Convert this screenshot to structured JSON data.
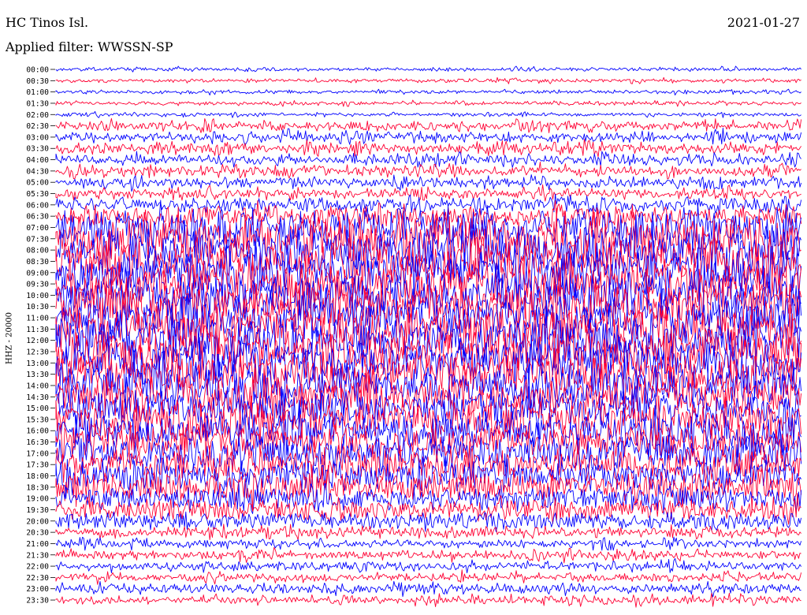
{
  "header": {
    "station": "HC Tinos Isl.",
    "date": "2021-01-27",
    "filter_text": "Applied filter: WWSSN-SP"
  },
  "chart_data": {
    "type": "line",
    "title": "HC Tinos Isl.",
    "date": "2021-01-27",
    "filter": "Applied filter: WWSSN-SP",
    "ylabel": "HHZ - 20000",
    "tick_labels": [
      "00:00",
      "00:30",
      "01:00",
      "01:30",
      "02:00",
      "02:30",
      "03:00",
      "03:30",
      "04:00",
      "04:30",
      "05:00",
      "05:30",
      "06:00",
      "06:30",
      "07:00",
      "07:30",
      "08:00",
      "08:30",
      "09:00",
      "09:30",
      "10:00",
      "10:30",
      "11:00",
      "11:30",
      "12:00",
      "12:30",
      "13:00",
      "13:30",
      "14:00",
      "14:30",
      "15:00",
      "15:30",
      "16:00",
      "16:30",
      "17:00",
      "17:30",
      "18:00",
      "18:30",
      "19:00",
      "19:30",
      "20:00",
      "20:30",
      "21:00",
      "21:30",
      "22:00",
      "22:30",
      "23:00",
      "23:30"
    ],
    "trace_minutes": 30,
    "trace_colors": [
      "#0000ff",
      "#ff0033"
    ],
    "relative_amplitude": [
      0.1,
      0.1,
      0.1,
      0.1,
      0.1,
      0.12,
      0.15,
      0.15,
      0.15,
      0.15,
      0.15,
      0.15,
      0.2,
      0.35,
      0.8,
      1.0,
      1.0,
      1.0,
      1.0,
      1.0,
      1.0,
      1.0,
      1.0,
      1.0,
      1.0,
      1.0,
      1.0,
      1.0,
      0.9,
      0.8,
      0.8,
      0.8,
      0.7,
      0.7,
      0.7,
      0.7,
      0.6,
      0.6,
      0.45,
      0.35,
      0.25,
      0.15,
      0.12,
      0.12,
      0.12,
      0.12,
      0.15,
      0.12
    ],
    "grid": false
  }
}
